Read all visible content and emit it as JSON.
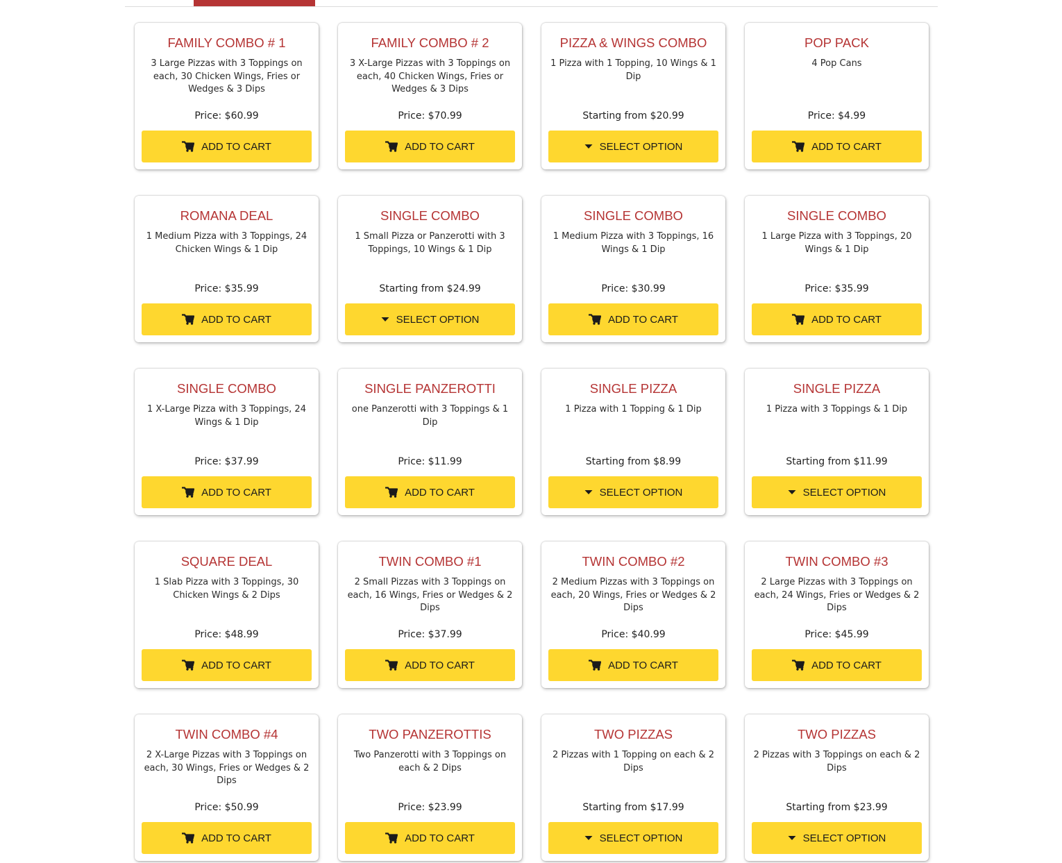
{
  "colors": {
    "accent": "#b53434",
    "button": "#fed72f"
  },
  "products": [
    {
      "title": "FAMILY COMBO # 1",
      "desc": "3 Large Pizzas with 3 Toppings on each, 30 Chicken Wings, Fries or Wedges & 3 Dips",
      "price": "Price: $60.99",
      "button": "ADD TO CART",
      "icon": "cart-icon"
    },
    {
      "title": "FAMILY COMBO # 2",
      "desc": "3 X-Large Pizzas with 3 Toppings on each, 40 Chicken Wings, Fries or Wedges & 3 Dips",
      "price": "Price: $70.99",
      "button": "ADD TO CART",
      "icon": "cart-icon"
    },
    {
      "title": "PIZZA & WINGS COMBO",
      "desc": "1 Pizza with 1 Topping, 10 Wings & 1 Dip",
      "price": "Starting from $20.99",
      "button": "SELECT OPTION",
      "icon": "caret-down-icon"
    },
    {
      "title": "POP PACK",
      "desc": "4 Pop Cans",
      "price": "Price: $4.99",
      "button": "ADD TO CART",
      "icon": "cart-icon"
    },
    {
      "title": "ROMANA DEAL",
      "desc": "1 Medium Pizza with 3 Toppings, 24 Chicken Wings & 1 Dip",
      "price": "Price: $35.99",
      "button": "ADD TO CART",
      "icon": "cart-icon"
    },
    {
      "title": "SINGLE COMBO",
      "desc": "1 Small Pizza or Panzerotti with 3 Toppings, 10 Wings & 1 Dip",
      "price": "Starting from $24.99",
      "button": "SELECT OPTION",
      "icon": "caret-down-icon"
    },
    {
      "title": "SINGLE COMBO",
      "desc": "1 Medium Pizza with 3 Toppings, 16 Wings & 1 Dip",
      "price": "Price: $30.99",
      "button": "ADD TO CART",
      "icon": "cart-icon"
    },
    {
      "title": "SINGLE COMBO",
      "desc": "1 Large Pizza with 3 Toppings, 20 Wings & 1 Dip",
      "price": "Price: $35.99",
      "button": "ADD TO CART",
      "icon": "cart-icon"
    },
    {
      "title": "SINGLE COMBO",
      "desc": "1 X-Large Pizza with 3 Toppings, 24 Wings & 1 Dip",
      "price": "Price: $37.99",
      "button": "ADD TO CART",
      "icon": "cart-icon"
    },
    {
      "title": "SINGLE PANZEROTTI",
      "desc": "one Panzerotti with 3 Toppings & 1 Dip",
      "price": "Price: $11.99",
      "button": "ADD TO CART",
      "icon": "cart-icon"
    },
    {
      "title": "SINGLE PIZZA",
      "desc": "1 Pizza with 1 Topping & 1 Dip",
      "price": "Starting from $8.99",
      "button": "SELECT OPTION",
      "icon": "caret-down-icon"
    },
    {
      "title": "SINGLE PIZZA",
      "desc": "1 Pizza with 3 Toppings & 1 Dip",
      "price": "Starting from $11.99",
      "button": "SELECT OPTION",
      "icon": "caret-down-icon"
    },
    {
      "title": "SQUARE DEAL",
      "desc": "1 Slab Pizza with 3 Toppings, 30 Chicken Wings & 2 Dips",
      "price": "Price: $48.99",
      "button": "ADD TO CART",
      "icon": "cart-icon"
    },
    {
      "title": "TWIN COMBO #1",
      "desc": "2 Small Pizzas with 3 Toppings on each, 16 Wings, Fries or Wedges & 2 Dips",
      "price": "Price: $37.99",
      "button": "ADD TO CART",
      "icon": "cart-icon"
    },
    {
      "title": "TWIN COMBO #2",
      "desc": "2 Medium Pizzas with 3 Toppings on each, 20 Wings, Fries or Wedges & 2 Dips",
      "price": "Price: $40.99",
      "button": "ADD TO CART",
      "icon": "cart-icon"
    },
    {
      "title": "TWIN COMBO #3",
      "desc": "2 Large Pizzas with 3 Toppings on each, 24 Wings, Fries or Wedges & 2 Dips",
      "price": "Price: $45.99",
      "button": "ADD TO CART",
      "icon": "cart-icon"
    },
    {
      "title": "TWIN COMBO #4",
      "desc": "2 X-Large Pizzas with 3 Toppings on each, 30 Wings, Fries or Wedges & 2 Dips",
      "price": "Price: $50.99",
      "button": "ADD TO CART",
      "icon": "cart-icon"
    },
    {
      "title": "TWO PANZEROTTIS",
      "desc": "Two Panzerotti with 3 Toppings on each & 2 Dips",
      "price": "Price: $23.99",
      "button": "ADD TO CART",
      "icon": "cart-icon"
    },
    {
      "title": "TWO PIZZAS",
      "desc": "2 Pizzas with 1 Topping on each & 2 Dips",
      "price": "Starting from $17.99",
      "button": "SELECT OPTION",
      "icon": "caret-down-icon"
    },
    {
      "title": "TWO PIZZAS",
      "desc": "2 Pizzas with 3 Toppings on each & 2 Dips",
      "price": "Starting from $23.99",
      "button": "SELECT OPTION",
      "icon": "caret-down-icon"
    }
  ]
}
